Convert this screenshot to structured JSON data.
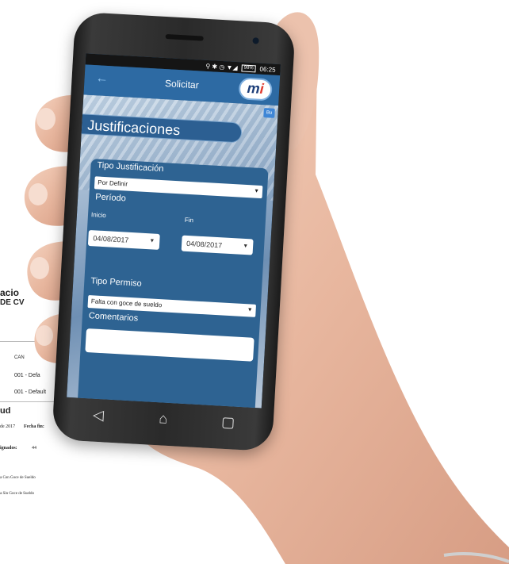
{
  "document": {
    "line1": "acio",
    "line2": "DE CV",
    "col_header": "CAN",
    "row1": "001 - Defa",
    "row2": "001 - Default",
    "section": "ud",
    "date_text": "de 2017",
    "fecha_label": "Fecha fin:",
    "nums": "23\n201",
    "asignados_label": "ignados:",
    "asignados_value": "44",
    "item1": "a Con Goce de Sueldo",
    "item2": "a Sin Goce de Sueldo"
  },
  "statusbar": {
    "icons": "⚲ ✱ ◷ ▼◢",
    "battery": "98%",
    "time": "06:25"
  },
  "appbar": {
    "back_icon": "←",
    "title": "Solicitar",
    "logo_m": "m",
    "logo_i": "i"
  },
  "badge": "Bu",
  "screen_title": "Justificaciones",
  "form": {
    "tipo_justificacion_label": "Tipo Justificación",
    "tipo_justificacion_value": "Por Definir",
    "periodo_label": "Período",
    "inicio_label": "Inicio",
    "fin_label": "Fin",
    "inicio_value": "04/08/2017",
    "fin_value": "04/08/2017",
    "tipo_permiso_label": "Tipo Permiso",
    "tipo_permiso_value": "Falta con goce de sueldo",
    "comentarios_label": "Comentarios",
    "comentarios_value": ""
  },
  "navbar": {
    "back": "◁",
    "home": "⌂",
    "recents": "▢"
  },
  "colors": {
    "appbar": "#2d6aa3",
    "form": "#2e6392",
    "accent_red": "#e03a2f"
  }
}
